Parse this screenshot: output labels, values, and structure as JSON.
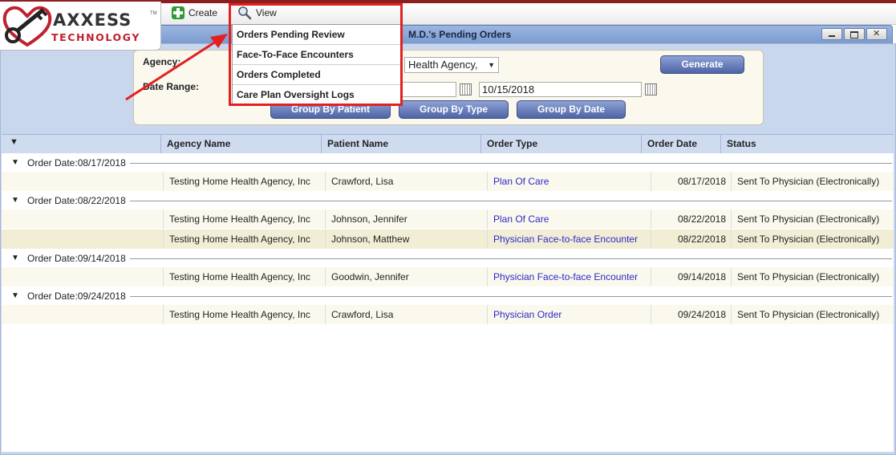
{
  "brand": {
    "line1": "AXXESS",
    "line2": "TECHNOLOGY",
    "tm": "TM"
  },
  "menu": {
    "create_label": "Create",
    "view_label": "View"
  },
  "view_dropdown": {
    "items": [
      "Orders Pending Review",
      "Face-To-Face Encounters",
      "Orders Completed",
      "Care Plan Oversight Logs"
    ]
  },
  "window": {
    "title": "M.D.'s Pending Orders"
  },
  "filters": {
    "agency_label": "Agency:",
    "agency_value": "Health Agency,",
    "date_range_label": "Date Range:",
    "end_date": "10/15/2018",
    "generate_label": "Generate",
    "group_by_patient_label": "Group By Patient",
    "group_by_type_label": "Group By Type",
    "group_by_date_label": "Group By Date"
  },
  "grid": {
    "columns": [
      "Agency Name",
      "Patient Name",
      "Order Type",
      "Order Date",
      "Status"
    ],
    "groups": [
      {
        "label": "Order Date:08/17/2018",
        "rows": [
          {
            "agency": "Testing Home Health Agency, Inc",
            "patient": "Crawford, Lisa",
            "order_type": "Plan Of Care",
            "order_date": "08/17/2018",
            "status": "Sent To Physician (Electronically)"
          }
        ]
      },
      {
        "label": "Order Date:08/22/2018",
        "rows": [
          {
            "agency": "Testing Home Health Agency, Inc",
            "patient": "Johnson, Jennifer",
            "order_type": "Plan Of Care",
            "order_date": "08/22/2018",
            "status": "Sent To Physician (Electronically)"
          },
          {
            "agency": "Testing Home Health Agency, Inc",
            "patient": "Johnson, Matthew",
            "order_type": "Physician Face-to-face Encounter",
            "order_date": "08/22/2018",
            "status": "Sent To Physician (Electronically)"
          }
        ]
      },
      {
        "label": "Order Date:09/14/2018",
        "rows": [
          {
            "agency": "Testing Home Health Agency, Inc",
            "patient": "Goodwin, Jennifer",
            "order_type": "Physician Face-to-face Encounter",
            "order_date": "09/14/2018",
            "status": "Sent To Physician (Electronically)"
          }
        ]
      },
      {
        "label": "Order Date:09/24/2018",
        "rows": [
          {
            "agency": "Testing Home Health Agency, Inc",
            "patient": "Crawford, Lisa",
            "order_type": "Physician Order",
            "order_date": "09/24/2018",
            "status": "Sent To Physician (Electronically)"
          }
        ]
      }
    ]
  },
  "colors": {
    "brand_red": "#c0212f",
    "link": "#2a29c8",
    "highlight": "#e32020",
    "button": "#4e64a4"
  },
  "icons": {
    "create": "plus-icon",
    "view": "magnifier-icon",
    "calendar": "calendar-icon",
    "collapse": "chevron-down-icon"
  }
}
